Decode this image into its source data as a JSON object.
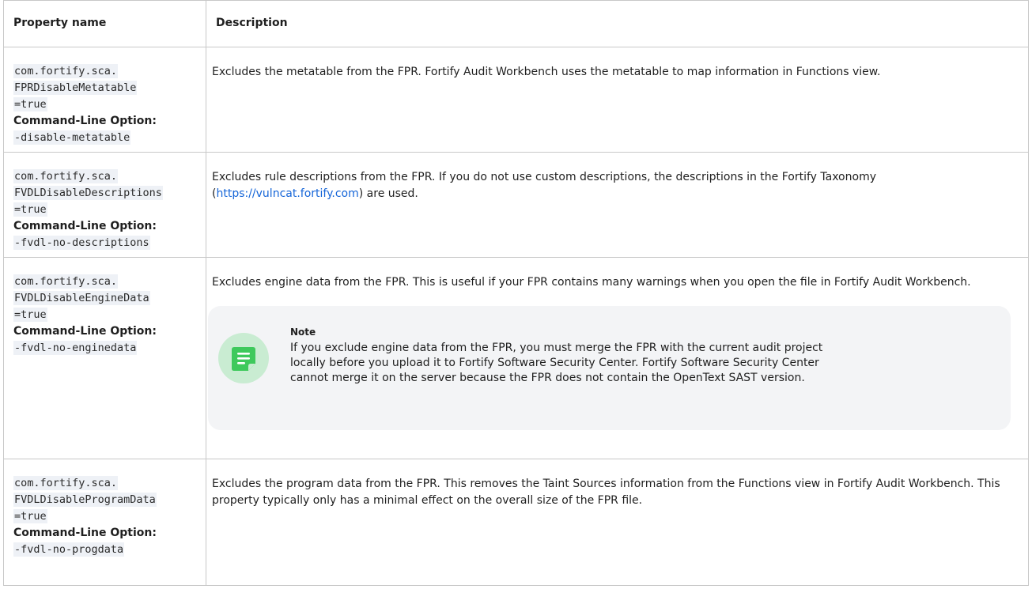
{
  "table": {
    "headers": {
      "property": "Property name",
      "description": "Description"
    },
    "cli_label": "Command-Line Option:",
    "rows": [
      {
        "property_lines": [
          "com.fortify.sca.",
          "FPRDisableMetatable",
          "=true"
        ],
        "cli_option": "-disable-metatable",
        "description": "Excludes the metatable from the FPR. Fortify Audit Workbench uses the metatable to map information in Functions view."
      },
      {
        "property_lines": [
          "com.fortify.sca.",
          "FVDLDisableDescriptions",
          "=true"
        ],
        "cli_option": "-fvdl-no-descriptions",
        "description_before_link": "Excludes rule descriptions from the FPR. If you do not use custom descriptions, the descriptions in the Fortify Taxonomy (",
        "link_text": "https://vulncat.fortify.com",
        "description_after_link": ") are used."
      },
      {
        "property_lines": [
          "com.fortify.sca.",
          "FVDLDisableEngineData",
          "=true"
        ],
        "cli_option": "-fvdl-no-enginedata",
        "description": "Excludes engine data from the FPR. This is useful if your FPR contains many warnings when you open the file in Fortify Audit Workbench.",
        "note": {
          "title": "Note",
          "icon": "note-icon",
          "body": "If you exclude engine data from the FPR, you must merge the FPR with the current audit project locally before you upload it to Fortify Software Security Center. Fortify Software Security Center cannot merge it on the server because the FPR does not contain the OpenText SAST version."
        }
      },
      {
        "property_lines": [
          "com.fortify.sca.",
          "FVDLDisableProgramData",
          "=true"
        ],
        "cli_option": "-fvdl-no-progdata",
        "description": "Excludes the program data from the FPR. This removes the Taint Sources information from the Functions view in Fortify Audit Workbench. This property typically only has a minimal effect on the overall size of the FPR file."
      }
    ]
  },
  "colors": {
    "note_bg": "#f3f4f6",
    "note_icon": "#3ec95c",
    "code_bg": "#eef1f6",
    "link": "#1565d8"
  }
}
